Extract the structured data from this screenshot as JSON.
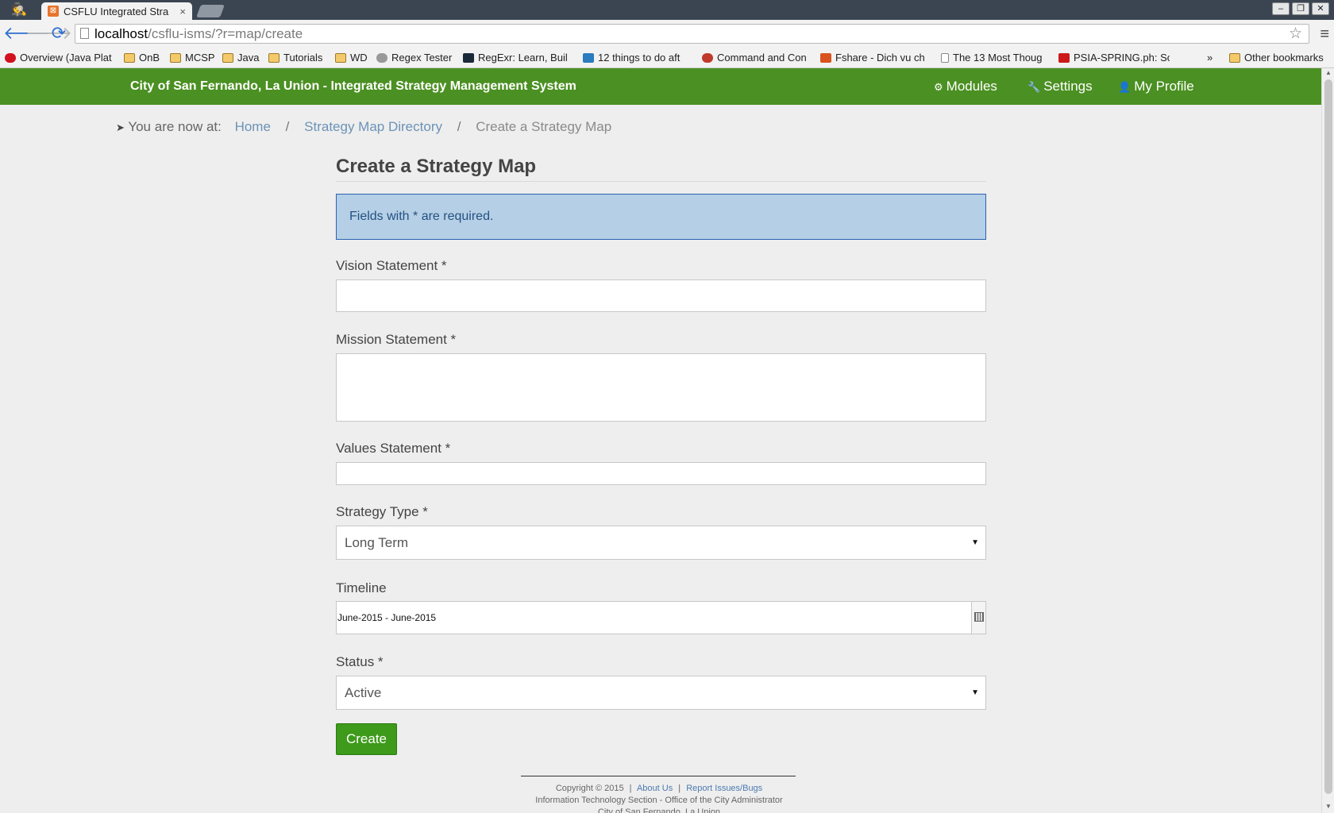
{
  "browser": {
    "tab_title": "CSFLU Integrated Stra",
    "tab_close": "×",
    "url_host": "localhost",
    "url_path": "/csflu-isms/?r=map/create",
    "window_controls": [
      "–",
      "❐",
      "✕"
    ],
    "bookmarks": [
      {
        "label": "Overview (Java Plat",
        "icon": "oracle-icon",
        "color": "#d3101f"
      },
      {
        "label": "OnB",
        "icon": "folder-icon"
      },
      {
        "label": "MCSP",
        "icon": "folder-icon"
      },
      {
        "label": "Java",
        "icon": "folder-icon"
      },
      {
        "label": "Tutorials",
        "icon": "folder-icon"
      },
      {
        "label": "WD",
        "icon": "folder-icon"
      },
      {
        "label": "Regex Tester",
        "icon": "gear-icon",
        "color": "#888888"
      },
      {
        "label": "RegExr: Learn, Buil",
        "icon": "regexr-icon",
        "color": "#1b2a3a"
      },
      {
        "label": "12 things to do aft",
        "icon": "wordpress-icon",
        "color": "#2a7bbf"
      },
      {
        "label": "Command and Con",
        "icon": "firefox-icon",
        "color": "#c0392b"
      },
      {
        "label": "Fshare - Dich vu ch",
        "icon": "fshare-icon",
        "color": "#d9531e"
      },
      {
        "label": "The 13 Most Thoug",
        "icon": "page-icon",
        "color": "#ffffff"
      },
      {
        "label": "PSIA-SPRING.ph: Sc",
        "icon": "youtube-icon",
        "color": "#cc1a1a"
      }
    ],
    "bookmarks_more": "»",
    "other_bookmarks": "Other bookmarks"
  },
  "navbar": {
    "brand": "City of San Fernando, La Union - Integrated Strategy Management System",
    "items": [
      {
        "label": "Modules",
        "icon": "cogs-icon"
      },
      {
        "label": "Settings",
        "icon": "wrench-icon"
      },
      {
        "label": "My Profile",
        "icon": "user-icon"
      }
    ],
    "color": "#4b9022"
  },
  "breadcrumb": {
    "prefix": "You are now at:",
    "home": "Home",
    "directory": "Strategy Map Directory",
    "current": "Create a Strategy Map",
    "separator": "/"
  },
  "form": {
    "title": "Create a Strategy Map",
    "notice": "Fields with * are required.",
    "vision_label": "Vision Statement *",
    "vision_value": "",
    "mission_label": "Mission Statement *",
    "mission_value": "",
    "values_label": "Values Statement *",
    "values_value": "",
    "strategy_type_label": "Strategy Type *",
    "strategy_type_value": "Long Term",
    "timeline_label": "Timeline",
    "timeline_value": "June-2015 - June-2015",
    "status_label": "Status *",
    "status_value": "Active",
    "submit_label": "Create"
  },
  "footer": {
    "copyright": "Copyright © 2015",
    "sep": "|",
    "about": "About Us",
    "report": "Report Issues/Bugs",
    "line2": "Information Technology Section - Office of the City Administrator",
    "line3": "City of San Fernando, La Union"
  }
}
